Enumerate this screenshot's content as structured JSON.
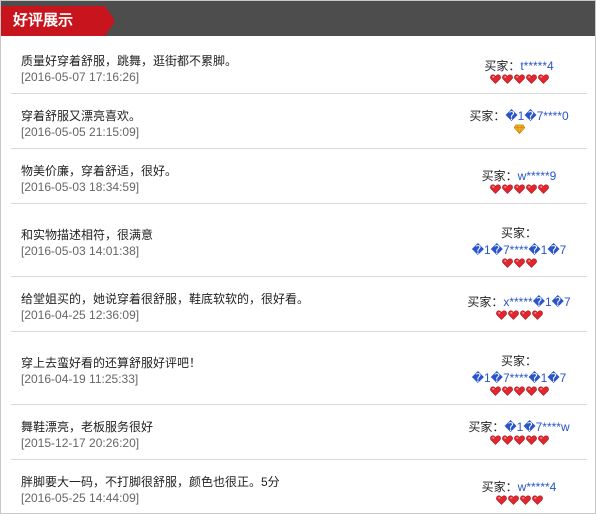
{
  "header": {
    "title": "好评展示"
  },
  "reviews": [
    {
      "comment": "质量好穿着舒服，跳舞，逛街都不累脚。",
      "time": "[2016-05-07 17:16:26]",
      "buyer_label": "买家：",
      "buyer_name": "t*****4",
      "buyer_name_line2": "",
      "rating": {
        "icon": "heart",
        "count": 5
      }
    },
    {
      "comment": "穿着舒服又漂亮喜欢。",
      "time": "[2016-05-05 21:15:09]",
      "buyer_label": "买家：",
      "buyer_name": "�1�7****0",
      "buyer_name_line2": "",
      "rating": {
        "icon": "diamond",
        "count": 1
      }
    },
    {
      "comment": "物美价廉，穿着舒适，很好。",
      "time": "[2016-05-03 18:34:59]",
      "buyer_label": "买家：",
      "buyer_name": "w*****9",
      "buyer_name_line2": "",
      "rating": {
        "icon": "heart",
        "count": 5
      }
    },
    {
      "comment": "和实物描述相符，很满意",
      "time": "[2016-05-03 14:01:38]",
      "buyer_label": "买家：",
      "buyer_name": "",
      "buyer_name_line2": "�1�7****�1�7",
      "rating": {
        "icon": "heart",
        "count": 3
      }
    },
    {
      "comment": "给堂姐买的，她说穿着很舒服，鞋底软软的，很好看。",
      "time": "[2016-04-25 12:36:09]",
      "buyer_label": "买家：",
      "buyer_name": "x*****�1�7",
      "buyer_name_line2": "",
      "rating": {
        "icon": "heart",
        "count": 4
      }
    },
    {
      "comment": "穿上去蛮好看的还算舒服好评吧！",
      "time": "[2016-04-19 11:25:33]",
      "buyer_label": "买家：",
      "buyer_name": "",
      "buyer_name_line2": "�1�7****�1�7",
      "rating": {
        "icon": "heart",
        "count": 5
      }
    },
    {
      "comment": "舞鞋漂亮，老板服务很好",
      "time": "[2015-12-17 20:26:20]",
      "buyer_label": "买家：",
      "buyer_name": "�1�7****w",
      "buyer_name_line2": "",
      "rating": {
        "icon": "heart",
        "count": 5
      }
    },
    {
      "comment": "胖脚要大一码，不打脚很舒服，颜色也很正。5分",
      "time": "[2016-05-25 14:44:09]",
      "buyer_label": "买家：",
      "buyer_name": "w*****4",
      "buyer_name_line2": "",
      "rating": {
        "icon": "heart",
        "count": 4
      }
    }
  ]
}
